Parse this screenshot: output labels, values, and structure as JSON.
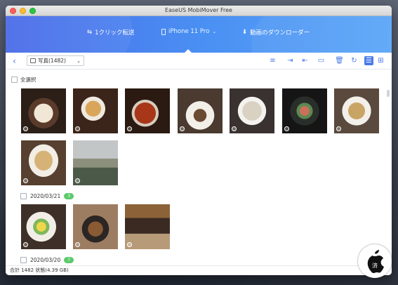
{
  "window": {
    "title": "EaseUS MobiMover Free"
  },
  "nav": {
    "items": [
      {
        "label": "1クリック転送",
        "icon": "transfer-arrows-icon"
      },
      {
        "label": "iPhone 11 Pro",
        "icon": "phone-icon"
      },
      {
        "label": "動画のダウンローダー",
        "icon": "download-icon"
      }
    ],
    "active_color": "#8fd6ff"
  },
  "toolbar": {
    "album_label": "写真(1482)",
    "icons": [
      "sort-icon",
      "export-to-pc-icon",
      "import-icon",
      "transfer-to-device-icon",
      "delete-icon",
      "refresh-icon",
      "list-view-icon",
      "grid-view-icon"
    ]
  },
  "content": {
    "select_all": "全選択",
    "groups": [
      {
        "date": "2020/03/21",
        "count": "3"
      },
      {
        "date": "2020/03/20",
        "count": "7"
      }
    ]
  },
  "status": {
    "text": "合計 1482 状態(4.39 GB)"
  },
  "colors": {
    "accent": "#4a7ae8",
    "badge": "#5cc96a"
  }
}
